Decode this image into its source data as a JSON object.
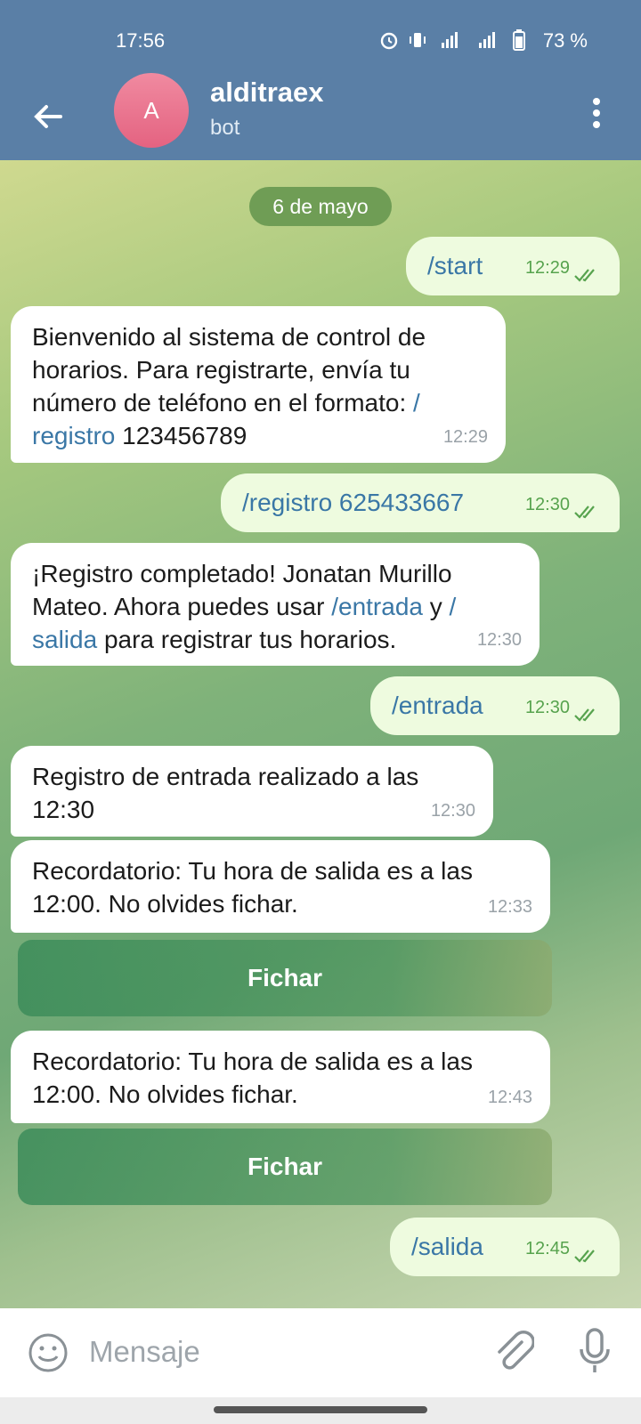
{
  "status_bar": {
    "time": "17:56",
    "battery": "73 %"
  },
  "header": {
    "avatar_letter": "A",
    "name": "alditraex",
    "subtitle": "bot"
  },
  "date_separator": "6 de mayo",
  "messages": [
    {
      "text": "/start",
      "time": "12:29"
    },
    {
      "text_parts": [
        "Bienvenido al sistema de control de horarios. Para registrarte, envía tu número de teléfono en el formato: ",
        "/ registro",
        " 123456789"
      ],
      "time": "12:29"
    },
    {
      "text": "/registro 625433667",
      "time": "12:30"
    },
    {
      "text_parts": [
        "¡Registro completado! Jonatan Murillo Mateo. Ahora puedes usar ",
        "/entrada",
        " y ",
        "/ salida",
        " para registrar tus horarios."
      ],
      "time": "12:30"
    },
    {
      "text": "/entrada",
      "time": "12:30"
    },
    {
      "text": "Registro de entrada realizado a las 12:30",
      "time": "12:30"
    },
    {
      "text": "Recordatorio: Tu hora de salida es a las 12:00. No olvides fichar.",
      "time": "12:33"
    },
    {
      "text": "Recordatorio: Tu hora de salida es a las 12:00. No olvides fichar.",
      "time": "12:43"
    },
    {
      "text": "/salida",
      "time": "12:45"
    }
  ],
  "buttons": {
    "fichar_1": "Fichar",
    "fichar_2": "Fichar"
  },
  "input": {
    "placeholder": "Mensaje"
  },
  "icons": [
    "back-arrow-icon",
    "more-vert-icon",
    "emoji-icon",
    "attach-icon",
    "mic-icon",
    "double-check-icon",
    "alarm-icon",
    "vibrate-icon",
    "signal-icon",
    "battery-icon"
  ]
}
